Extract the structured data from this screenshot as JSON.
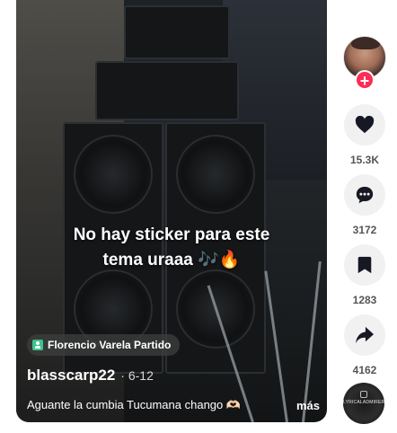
{
  "video": {
    "caption_line1": "No hay sticker para este",
    "caption_line2": "tema uraaa 🎶🔥",
    "location": "Florencio Varela Partido",
    "author": "blasscarp22",
    "date": "· 6-12",
    "description": "Aguante la cumbia Tucumana chango 🫶🏻",
    "more_label": "más"
  },
  "rail": {
    "follow_symbol": "+",
    "likes": "15.3K",
    "comments": "3172",
    "saves": "1283",
    "shares": "4162",
    "music_disc_text": "LYRICALADMIRER"
  },
  "colors": {
    "follow_badge": "#fe2c55",
    "rail_button_bg": "#f1f1f2",
    "icon": "#161823"
  }
}
